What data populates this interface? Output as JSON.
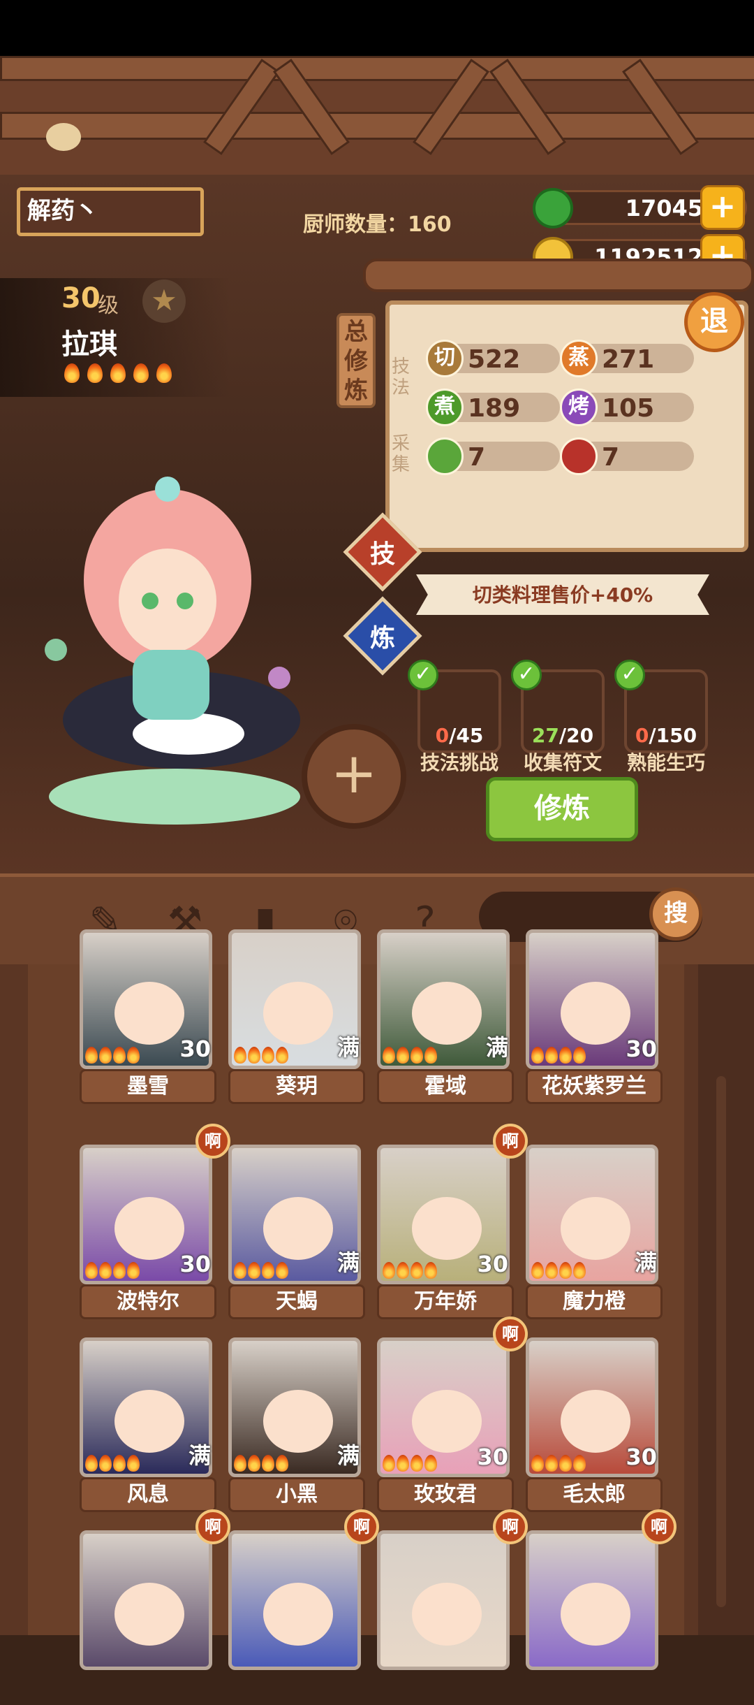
{
  "header": {
    "name_input": "解药丶",
    "chef_count_label": "厨师数量：",
    "chef_count": "160"
  },
  "currency": {
    "jade": "17045",
    "coins": "1192512"
  },
  "chef": {
    "level": "30",
    "level_suffix": "级",
    "name": "拉琪",
    "flames": 5
  },
  "cultivation": {
    "tag": "总修炼",
    "section_skill": "技法",
    "section_gather": "采集",
    "stats": [
      {
        "icon": "切",
        "value": "522",
        "color": "#a87a3a"
      },
      {
        "icon": "蒸",
        "value": "271",
        "color": "#e07a2a"
      },
      {
        "icon": "煮",
        "value": "189",
        "color": "#4d9a2a"
      },
      {
        "icon": "烤",
        "value": "105",
        "color": "#8a4ab8"
      },
      {
        "icon": "",
        "value": "7",
        "color": "#5aa63a"
      },
      {
        "icon": "",
        "value": "7",
        "color": "#b8322a"
      }
    ],
    "exit_label": "退",
    "skill_btn": "技",
    "refine_btn": "炼",
    "bonus": "切类料理售价+40%",
    "tasks": [
      {
        "done": "0",
        "total": "/45",
        "label": "技法挑战",
        "done_color": "#ff6a4a"
      },
      {
        "done": "27",
        "total": "/20",
        "label": "收集符文",
        "done_color": "#9be05a"
      },
      {
        "done": "0",
        "total": "/150",
        "label": "熟能生巧",
        "done_color": "#ff6a4a"
      }
    ],
    "train_btn": "修炼"
  },
  "toolbar": {
    "search_label": "搜"
  },
  "roster": [
    {
      "name": "墨雪",
      "badge": "30",
      "tag": "",
      "hue": "#3b4a52"
    },
    {
      "name": "葵玥",
      "badge": "满",
      "tag": "",
      "hue": "#d8dde0"
    },
    {
      "name": "霍域",
      "badge": "满",
      "tag": "",
      "hue": "#3f5a3a"
    },
    {
      "name": "花妖紫罗兰",
      "badge": "30",
      "tag": "",
      "hue": "#6a3a7a"
    },
    {
      "name": "波特尔",
      "badge": "30",
      "tag": "啊",
      "hue": "#7a4aa8"
    },
    {
      "name": "天蝎",
      "badge": "满",
      "tag": "",
      "hue": "#5a5aa0"
    },
    {
      "name": "万年娇",
      "badge": "30",
      "tag": "啊",
      "hue": "#b8b07a"
    },
    {
      "name": "魔力橙",
      "badge": "满",
      "tag": "",
      "hue": "#e8a4a0"
    },
    {
      "name": "风息",
      "badge": "满",
      "tag": "",
      "hue": "#2a2a5a"
    },
    {
      "name": "小黑",
      "badge": "满",
      "tag": "",
      "hue": "#3a2a22"
    },
    {
      "name": "玫玫君",
      "badge": "30",
      "tag": "啊",
      "hue": "#e8a0b8"
    },
    {
      "name": "毛太郎",
      "badge": "30",
      "tag": "",
      "hue": "#b84a3a"
    },
    {
      "name": "",
      "badge": "",
      "tag": "啊",
      "hue": "#5a4a6a"
    },
    {
      "name": "",
      "badge": "",
      "tag": "啊",
      "hue": "#4a5ab8"
    },
    {
      "name": "",
      "badge": "",
      "tag": "啊",
      "hue": "#e8d8c8"
    },
    {
      "name": "",
      "badge": "",
      "tag": "啊",
      "hue": "#8a6ac8"
    }
  ]
}
